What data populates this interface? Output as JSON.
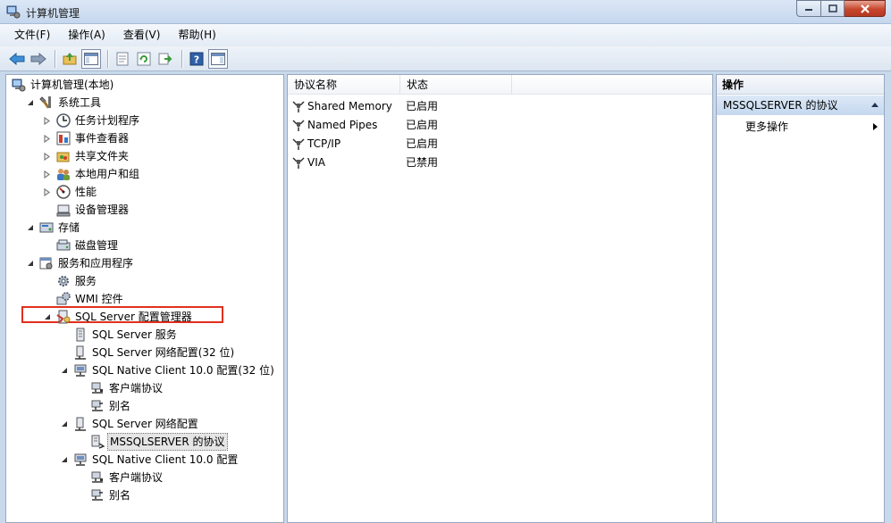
{
  "window": {
    "title": "计算机管理"
  },
  "menu": [
    "文件(F)",
    "操作(A)",
    "查看(V)",
    "帮助(H)"
  ],
  "tree": [
    {
      "label": "计算机管理(本地)",
      "level": 0,
      "expander": "none",
      "icon": "computer-management-icon"
    },
    {
      "label": "系统工具",
      "level": 1,
      "expander": "expanded",
      "icon": "system-tools-icon"
    },
    {
      "label": "任务计划程序",
      "level": 2,
      "expander": "collapsed",
      "icon": "clock-icon"
    },
    {
      "label": "事件查看器",
      "level": 2,
      "expander": "collapsed",
      "icon": "event-viewer-icon"
    },
    {
      "label": "共享文件夹",
      "level": 2,
      "expander": "collapsed",
      "icon": "shared-folder-icon"
    },
    {
      "label": "本地用户和组",
      "level": 2,
      "expander": "collapsed",
      "icon": "users-icon"
    },
    {
      "label": "性能",
      "level": 2,
      "expander": "collapsed",
      "icon": "performance-icon"
    },
    {
      "label": "设备管理器",
      "level": 2,
      "expander": "none",
      "icon": "device-manager-icon"
    },
    {
      "label": "存储",
      "level": 1,
      "expander": "expanded",
      "icon": "storage-icon"
    },
    {
      "label": "磁盘管理",
      "level": 2,
      "expander": "none",
      "icon": "disk-icon"
    },
    {
      "label": "服务和应用程序",
      "level": 1,
      "expander": "expanded",
      "icon": "services-apps-icon"
    },
    {
      "label": "服务",
      "level": 2,
      "expander": "none",
      "icon": "services-gear-icon"
    },
    {
      "label": "WMI 控件",
      "level": 2,
      "expander": "none",
      "icon": "wmi-icon"
    },
    {
      "label": "SQL Server 配置管理器",
      "level": 2,
      "expander": "expanded",
      "icon": "sql-config-icon"
    },
    {
      "label": "SQL Server 服务",
      "level": 3,
      "expander": "none",
      "icon": "server-icon"
    },
    {
      "label": "SQL Server 网络配置(32 位)",
      "level": 3,
      "expander": "none",
      "icon": "network-config-icon"
    },
    {
      "label": "SQL Native Client 10.0 配置(32 位)",
      "level": 3,
      "expander": "expanded",
      "icon": "native-client-icon"
    },
    {
      "label": "客户端协议",
      "level": 4,
      "expander": "none",
      "icon": "client-protocol-icon"
    },
    {
      "label": "别名",
      "level": 4,
      "expander": "none",
      "icon": "alias-icon"
    },
    {
      "label": "SQL Server 网络配置",
      "level": 3,
      "expander": "expanded",
      "icon": "network-config-icon"
    },
    {
      "label": "MSSQLSERVER 的协议",
      "level": 4,
      "expander": "none",
      "icon": "protocol-icon",
      "selected": true
    },
    {
      "label": "SQL Native Client 10.0 配置",
      "level": 3,
      "expander": "expanded",
      "icon": "native-client-icon"
    },
    {
      "label": "客户端协议",
      "level": 4,
      "expander": "none",
      "icon": "client-protocol-icon"
    },
    {
      "label": "别名",
      "level": 4,
      "expander": "none",
      "icon": "alias-icon"
    }
  ],
  "list": {
    "columns": [
      "协议名称",
      "状态"
    ],
    "rows": [
      {
        "name": "Shared Memory",
        "status": "已启用"
      },
      {
        "name": "Named Pipes",
        "status": "已启用"
      },
      {
        "name": "TCP/IP",
        "status": "已启用"
      },
      {
        "name": "VIA",
        "status": "已禁用"
      }
    ]
  },
  "actions": {
    "header": "操作",
    "section": "MSSQLSERVER 的协议",
    "more": "更多操作"
  },
  "colors": {
    "highlight": "#e0301e",
    "section_bg": "#c4d8ef"
  }
}
